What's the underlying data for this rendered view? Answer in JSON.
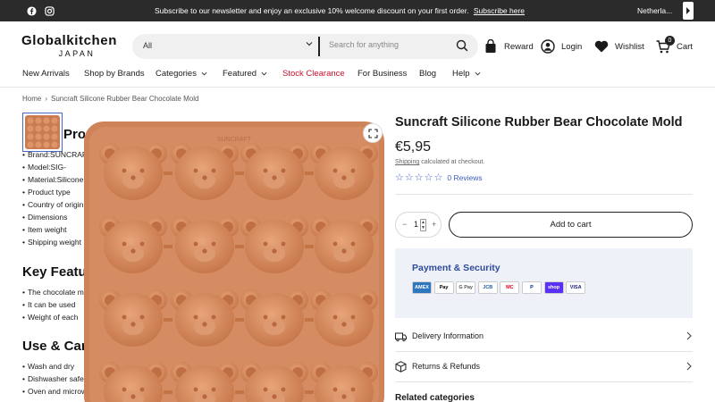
{
  "announcement": {
    "message": "Subscribe to our newsletter and enjoy an exclusive 10% welcome discount on your first order.",
    "link_text": "Subscribe here",
    "region": "Netherla..."
  },
  "header": {
    "logo_line1": "Globalkitchen",
    "logo_line2": "JAPAN",
    "search_category": "All",
    "search_placeholder": "Search for anything",
    "reward_label": "Reward",
    "login_label": "Login",
    "wishlist_label": "Wishlist",
    "cart_label": "Cart",
    "cart_count": "0"
  },
  "nav": [
    {
      "label": "New Arrivals"
    },
    {
      "label": "Shop by Brands"
    },
    {
      "label": "Categories"
    },
    {
      "label": "Featured"
    },
    {
      "label": "Stock Clearance"
    },
    {
      "label": "For Business"
    },
    {
      "label": "Blog"
    },
    {
      "label": "Help"
    }
  ],
  "breadcrumb": {
    "home": "Home",
    "current": "Suncraft Silicone Rubber Bear Chocolate Mold"
  },
  "description": {
    "heading_specs": "Product Specifications",
    "specs": [
      "Brand:SUNCRAFT",
      "Model:SIG-",
      "Material:Silicone",
      "Product type",
      "Country of origin",
      "Dimensions",
      "Item weight",
      "Shipping weight"
    ],
    "heading_features": "Key Features",
    "features": [
      "The chocolate mold",
      "It can be used",
      "Weight of each"
    ],
    "heading_care": "Use & Care",
    "care": [
      "Wash and dry",
      "Dishwasher safe",
      "Oven and microwave"
    ]
  },
  "product": {
    "title": "Suncraft Silicone Rubber Bear Chocolate Mold",
    "price": "€5,95",
    "shipping_link": "Shipping",
    "shipping_text": "calculated at checkout.",
    "reviews": "0 Reviews",
    "rating": 0,
    "quantity": "1",
    "add_to_cart": "Add to cart",
    "mold_brand_text": "SUNCRAFT",
    "mold_color": "#d4875c"
  },
  "payment": {
    "heading": "Payment & Security",
    "methods": [
      {
        "name": "AMEX",
        "bg": "#2e77bc",
        "fg": "#ffffff"
      },
      {
        "name": "Pay",
        "bg": "#ffffff",
        "fg": "#000000"
      },
      {
        "name": "G Pay",
        "bg": "#ffffff",
        "fg": "#555555"
      },
      {
        "name": "JCB",
        "bg": "#ffffff",
        "fg": "#1b5ea8"
      },
      {
        "name": "MC",
        "bg": "#ffffff",
        "fg": "#eb001b"
      },
      {
        "name": "P",
        "bg": "#ffffff",
        "fg": "#003087"
      },
      {
        "name": "shop",
        "bg": "#5a31f4",
        "fg": "#ffffff"
      },
      {
        "name": "VISA",
        "bg": "#ffffff",
        "fg": "#1a1f71"
      }
    ]
  },
  "info_rows": {
    "delivery": "Delivery Information",
    "returns": "Returns & Refunds"
  },
  "related_heading": "Related categories"
}
